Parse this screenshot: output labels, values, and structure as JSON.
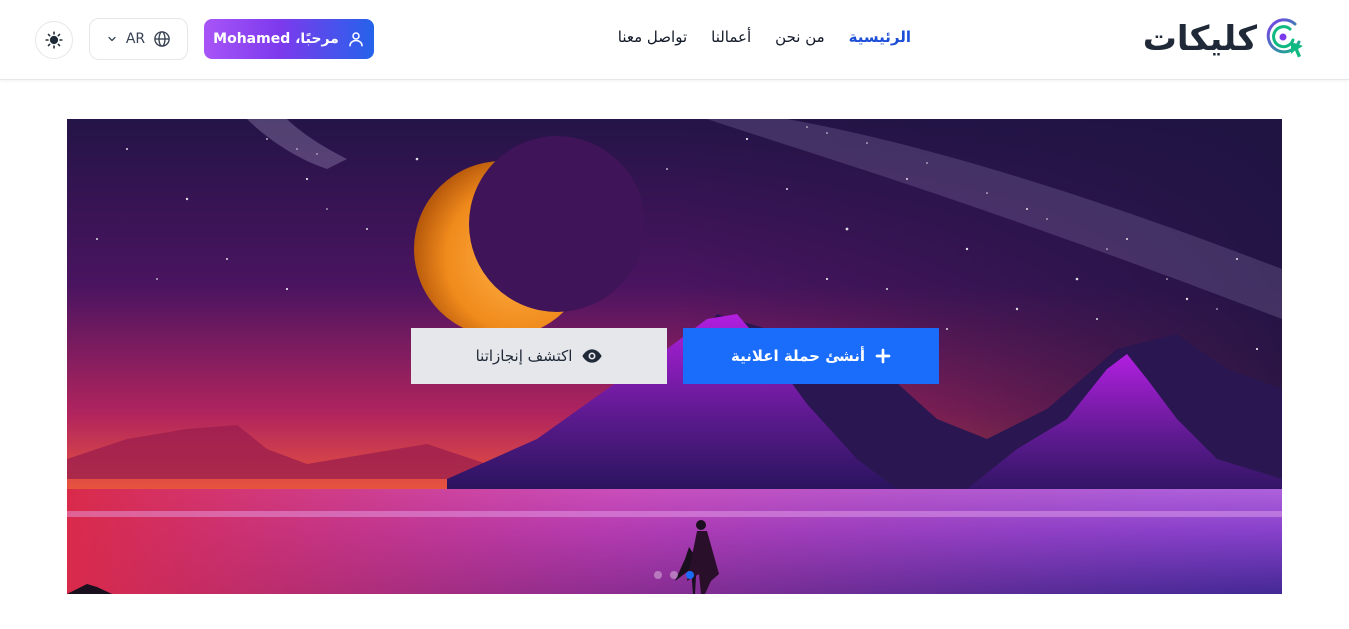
{
  "header": {
    "logo_text": "كليكات",
    "nav": [
      {
        "label": "الرئيسية",
        "active": true
      },
      {
        "label": "من نحن",
        "active": false
      },
      {
        "label": "أعمالنا",
        "active": false
      },
      {
        "label": "تواصل معنا",
        "active": false
      }
    ],
    "user_button_label": "مرحبًا، Mohamed",
    "language": "AR",
    "icons": {
      "theme": "sun-icon",
      "language": "globe-icon",
      "dropdown": "chevron-down-icon",
      "user": "user-icon",
      "logo": "cursor-click-icon"
    }
  },
  "hero": {
    "primary_cta": "أنشئ حملة اعلانية",
    "secondary_cta": "اكتشف إنجازاتنا",
    "slide_count": 3,
    "active_slide": 2
  },
  "colors": {
    "primary": "#1a6cfa",
    "user_button_gradient": [
      "#a855f7",
      "#2563eb"
    ]
  }
}
